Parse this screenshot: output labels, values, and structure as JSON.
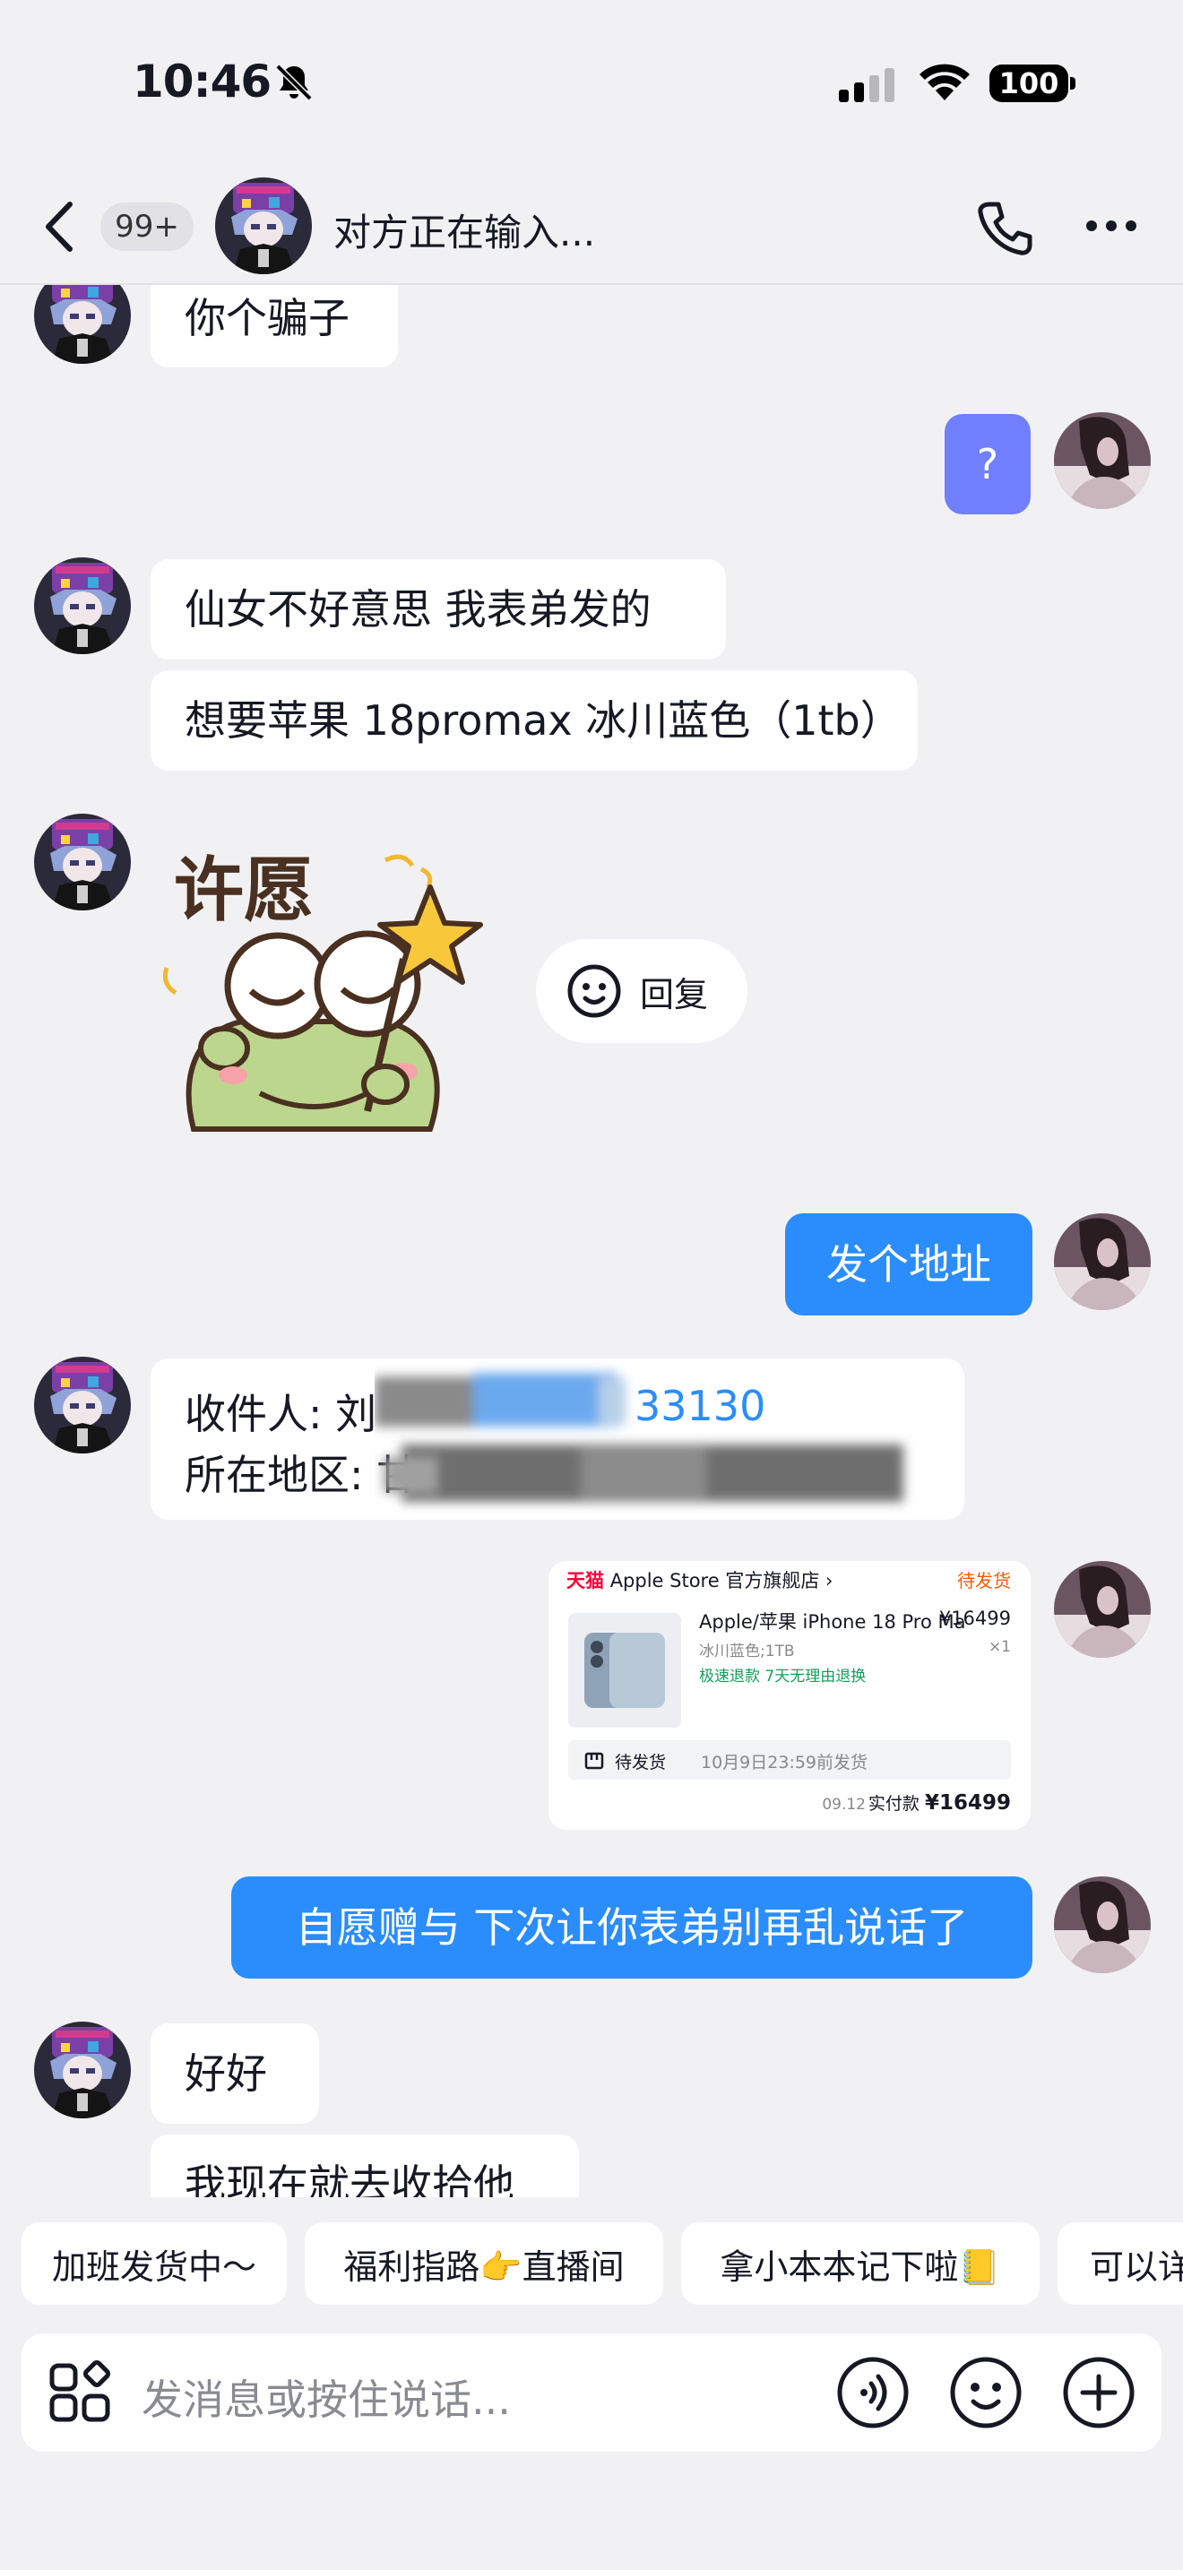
{
  "status_bar": {
    "time": "10:46",
    "battery": "100"
  },
  "header": {
    "badge": "99+",
    "title": "对方正在输入..."
  },
  "messages": {
    "m1": "你个骗子",
    "m2": "?",
    "m3": "仙女不好意思 我表弟发的",
    "m4": "想要苹果 18promax 冰川蓝色（1tb）",
    "sticker_text": "许愿",
    "reply_label": "回复",
    "m5": "发个地址",
    "address_line1_label": "收件人: 刘",
    "address_line1_tail": "33130",
    "address_line2_label": "所在地区: 甘",
    "m6": "自愿赠与 下次让你表弟别再乱说话了",
    "m7": "好好",
    "m8": "我现在就去收拾他"
  },
  "order_card": {
    "store_brand": "天猫",
    "store_name": "Apple Store 官方旗舰店 ›",
    "status": "待发货",
    "product_title": "Apple/苹果 iPhone 18 Pro Ma",
    "price": "¥16499",
    "spec": "冰川蓝色;1TB",
    "qty": "×1",
    "tags": "极速退款  7天无理由退换",
    "ship_label": "待发货",
    "ship_time": "10月9日23:59前发货",
    "date": "09.12",
    "paid_label": "实付款",
    "paid_amount": "¥16499"
  },
  "quick_replies": [
    "加班发货中～",
    "福利指路👉直播间",
    "拿小本本记下啦📒",
    "可以详"
  ],
  "input": {
    "placeholder": "发消息或按住说话..."
  },
  "colors": {
    "outgoing_bubble": "#2a8dfb",
    "question_bubble": "#6f7ffd",
    "background": "#f1f1f3"
  }
}
